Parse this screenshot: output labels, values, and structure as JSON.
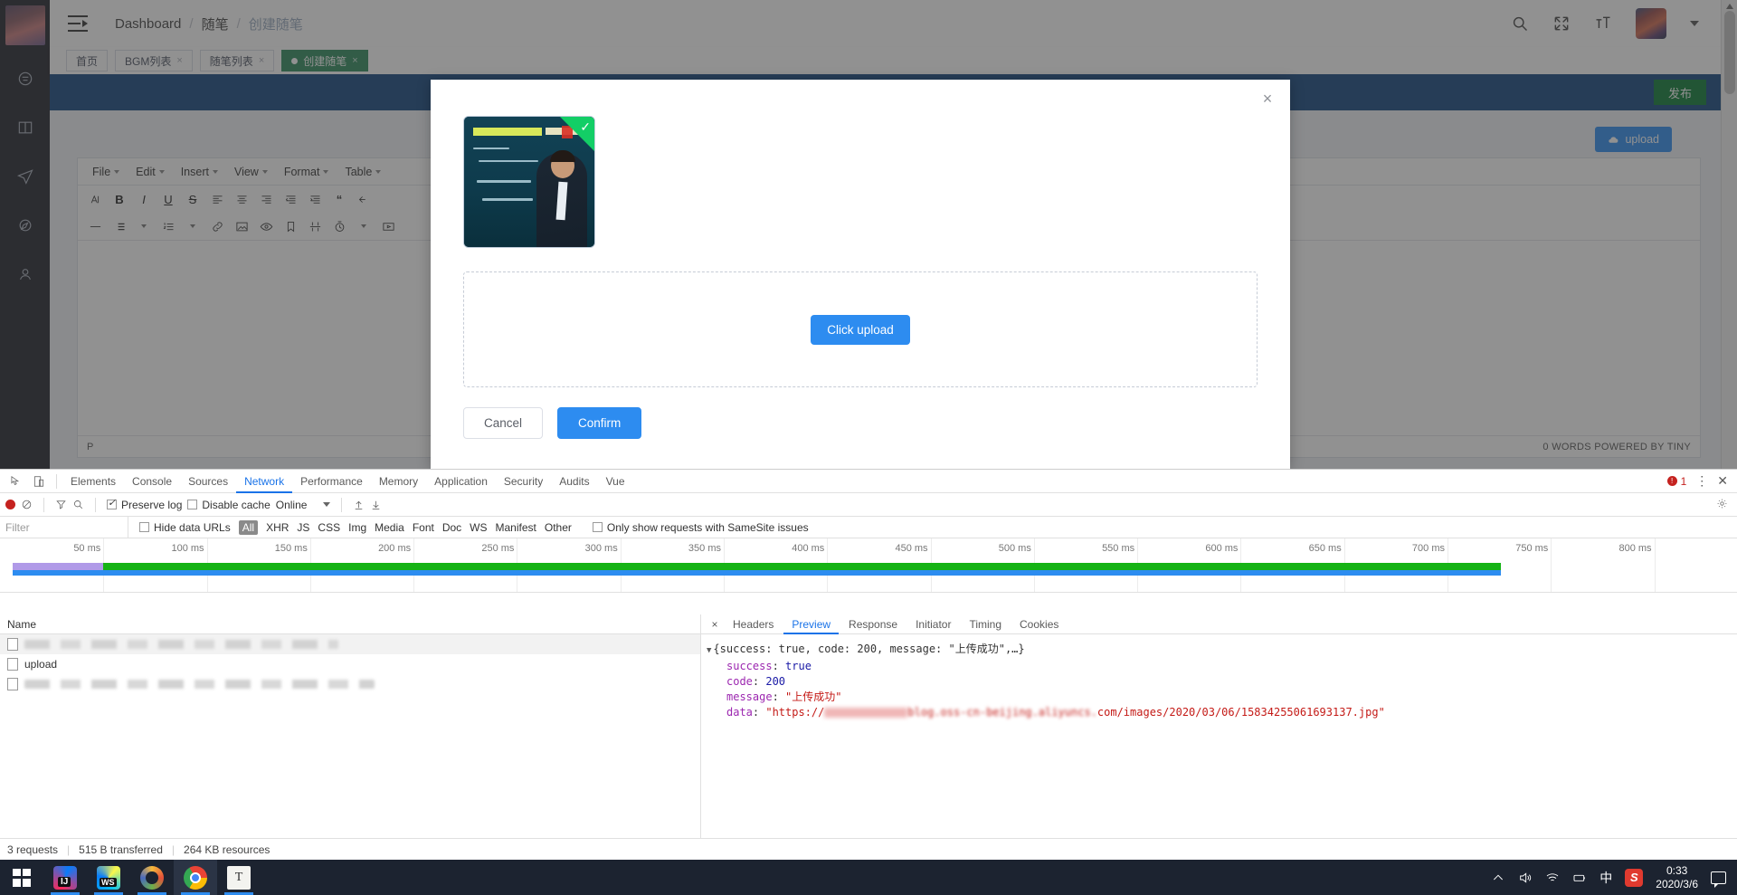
{
  "header": {
    "breadcrumb": [
      "Dashboard",
      "随笔",
      "创建随笔"
    ],
    "sep": "/",
    "icons": [
      "search-icon",
      "fullscreen-icon",
      "text-size-icon",
      "avatar"
    ]
  },
  "tabs": [
    {
      "label": "首页",
      "closable": false,
      "active": false
    },
    {
      "label": "BGM列表",
      "closable": true,
      "active": false
    },
    {
      "label": "随笔列表",
      "closable": true,
      "active": false
    },
    {
      "label": "创建随笔",
      "closable": true,
      "active": true
    }
  ],
  "tab_close_glyph": "×",
  "banner": {
    "publish_label": "发布"
  },
  "editor": {
    "upload_label": "upload",
    "menus": [
      "File",
      "Edit",
      "Insert",
      "View",
      "Format",
      "Table"
    ],
    "toolbar_row1": [
      "font-select-icon",
      "B",
      "I",
      "U",
      "S",
      "align-left-icon",
      "align-center-icon",
      "align-right-icon",
      "outdent-icon",
      "indent-icon",
      "blockquote-icon",
      "undo-icon"
    ],
    "toolbar_row2": [
      "horizontal-rule-icon",
      "bullet-list-icon",
      "numbered-list-icon",
      "link-icon",
      "image-icon",
      "preview-icon",
      "bookmark-icon",
      "page-break-icon",
      "insert-time-icon",
      "media-icon"
    ],
    "element_path": "P",
    "word_count": "0 WORDS POWERED BY TINY"
  },
  "modal": {
    "close_glyph": "×",
    "thumbnail_alt": "uploaded-lecture-blackboard-image",
    "thumbnail_selected": true,
    "check_glyph": "✓",
    "click_upload_label": "Click upload",
    "cancel_label": "Cancel",
    "confirm_label": "Confirm"
  },
  "devtools": {
    "panel_tabs": [
      "Elements",
      "Console",
      "Sources",
      "Network",
      "Performance",
      "Memory",
      "Application",
      "Security",
      "Audits",
      "Vue"
    ],
    "active_panel": "Network",
    "error_count": "1",
    "toolbar": {
      "record_label": "record-button",
      "clear_label": "clear-button",
      "filter_label": "filter-button",
      "search_label": "search-button",
      "preserve_log": "Preserve log",
      "preserve_log_checked": true,
      "disable_cache": "Disable cache",
      "disable_cache_checked": false,
      "throttle": "Online",
      "import_label": "import-har-button",
      "export_label": "export-har-button"
    },
    "filterbar": {
      "filter_placeholder": "Filter",
      "hide_data_urls": "Hide data URLs",
      "types": [
        "All",
        "XHR",
        "JS",
        "CSS",
        "Img",
        "Media",
        "Font",
        "Doc",
        "WS",
        "Manifest",
        "Other"
      ],
      "selected_type": "All",
      "samesite": "Only show requests with SameSite issues"
    },
    "timeline": {
      "ticks": [
        "50 ms",
        "100 ms",
        "150 ms",
        "200 ms",
        "250 ms",
        "300 ms",
        "350 ms",
        "400 ms",
        "450 ms",
        "500 ms",
        "550 ms",
        "600 ms",
        "650 ms",
        "700 ms",
        "750 ms",
        "800 ms"
      ]
    },
    "requests": {
      "column_header": "Name",
      "rows": [
        {
          "name": "",
          "redacted": true
        },
        {
          "name": "upload",
          "redacted": false
        },
        {
          "name": "",
          "redacted": true
        }
      ]
    },
    "detail": {
      "tabs": [
        "Headers",
        "Preview",
        "Response",
        "Initiator",
        "Timing",
        "Cookies"
      ],
      "active_tab": "Preview",
      "close_glyph": "×",
      "preview": {
        "summary": "{success: true, code: 200, message: \"上传成功\",…}",
        "fields": [
          {
            "key": "success",
            "value": "true",
            "kind": "bool"
          },
          {
            "key": "code",
            "value": "200",
            "kind": "num"
          },
          {
            "key": "message",
            "value": "\"上传成功\"",
            "kind": "str"
          }
        ],
        "data_key": "data",
        "data_prefix": "\"https://",
        "data_suffix": "com/images/2020/03/06/15834255061693137.jpg\"",
        "data_redacted_middle": "blog.oss-cn-beijing.aliyuncs."
      }
    },
    "status": {
      "requests": "3 requests",
      "transferred": "515 B transferred",
      "resources": "264 KB resources"
    }
  },
  "taskbar": {
    "apps": [
      "start-button",
      "intellij-idea-icon",
      "webstorm-icon",
      "ring-app-icon",
      "chrome-icon",
      "notes-icon"
    ],
    "active_app": "chrome-icon",
    "tray": [
      "show-hidden-icons-icon",
      "volume-icon",
      "wifi-icon",
      "battery-icon",
      "ime-icon",
      "sogou-input-icon"
    ],
    "ime_label": "中",
    "time": "0:33",
    "date": "2020/3/6",
    "notification_icon": "action-center-icon"
  },
  "colors": {
    "accent_blue": "#2d8cf0",
    "banner_blue": "#13457f",
    "publish_green": "#0b7a33",
    "tab_green": "#2d8a5c",
    "devtools_active": "#1a73e8",
    "error_red": "#c5221f",
    "timeline_green": "#15b315"
  }
}
